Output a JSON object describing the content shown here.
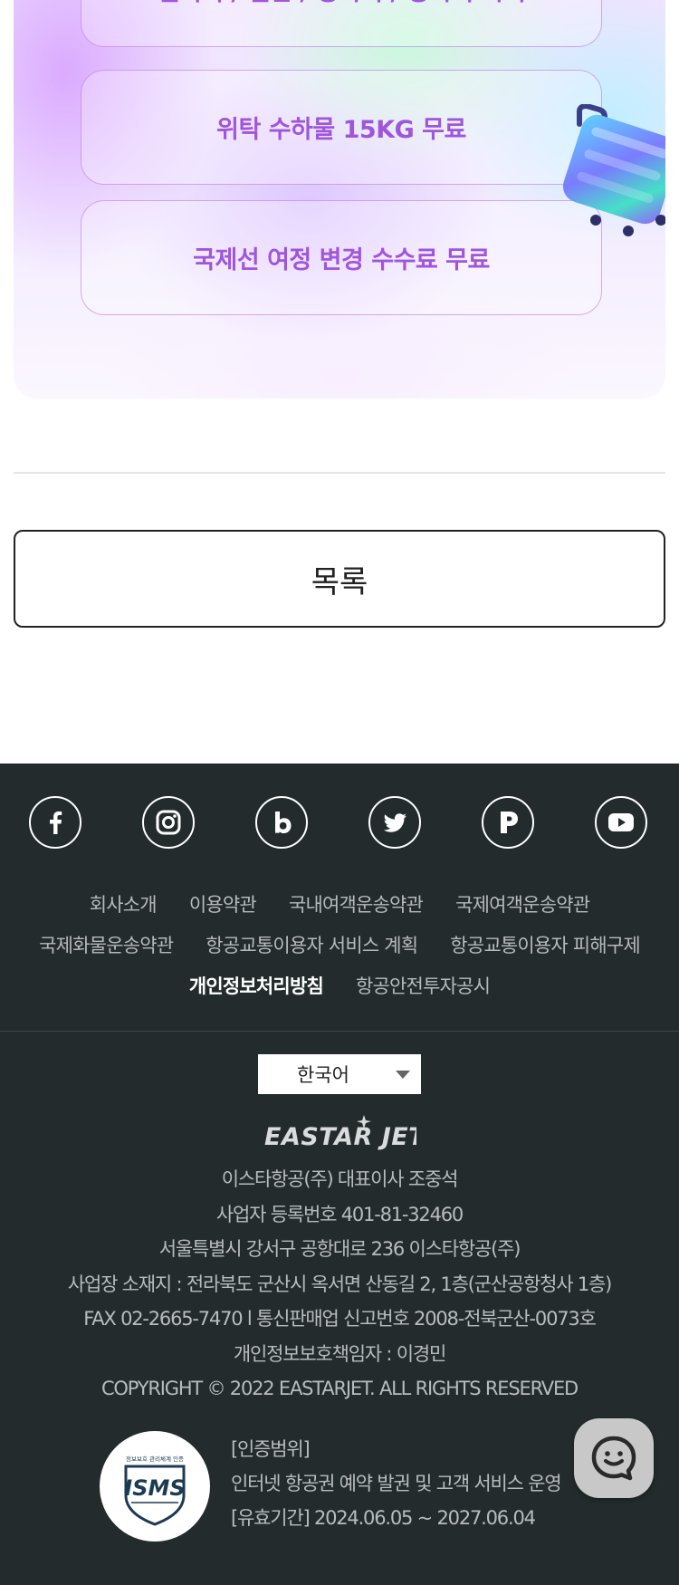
{
  "promo": {
    "benefits": [
      "필터피 / 일반 / 항목이 / 항목이 목적",
      "위탁 수하물 15KG 무료",
      "국제선 여정 변경 수수료 무료"
    ],
    "suitcase_icon": "suitcase-icon"
  },
  "list_button": {
    "label": "목록"
  },
  "footer": {
    "sns": [
      {
        "name": "facebook",
        "icon": "facebook-icon"
      },
      {
        "name": "instagram",
        "icon": "instagram-icon"
      },
      {
        "name": "blog",
        "icon": "blog-icon"
      },
      {
        "name": "twitter",
        "icon": "twitter-icon"
      },
      {
        "name": "post",
        "icon": "post-icon"
      },
      {
        "name": "youtube",
        "icon": "youtube-icon"
      }
    ],
    "links": {
      "row1": [
        "회사소개",
        "이용약관",
        "국내여객운송약관",
        "국제여객운송약관"
      ],
      "row2": [
        "국제화물운송약관",
        "항공교통이용자 서비스 계획",
        "항공교통이용자 피해구제"
      ],
      "row3": [
        "개인정보처리방침",
        "항공안전투자공시"
      ]
    },
    "language": {
      "selected": "한국어"
    },
    "logo_text": "EASTAR JET",
    "company_info": [
      "이스타항공(주) 대표이사 조중석",
      "사업자 등록번호 401-81-32460",
      "서울특별시 강서구 공항대로 236 이스타항공(주)",
      "사업장 소재지 : 전라북도 군산시 옥서면 산동길 2, 1층(군산공항청사 1층)",
      "FAX 02-2665-7470 l 통신판매업 신고번호 2008-전북군산-0073호",
      "개인정보보호책임자 : 이경민",
      "COPYRIGHT © 2022 EASTARJET. ALL RIGHTS RESERVED"
    ],
    "certification": {
      "badge_text": "ISMS",
      "badge_caption": "정보보호 관리체계 인증",
      "lines": [
        "[인증범위]",
        "인터넷 항공권 예약 발권 및 고객 서비스 운영",
        "[유효기간] 2024.06.05 ~ 2027.06.04"
      ]
    }
  },
  "chat": {
    "icon": "chat-icon"
  },
  "colors": {
    "benefit_text": "#a055dc",
    "footer_bg": "#232b2d",
    "footer_text": "#b9bcbd"
  }
}
